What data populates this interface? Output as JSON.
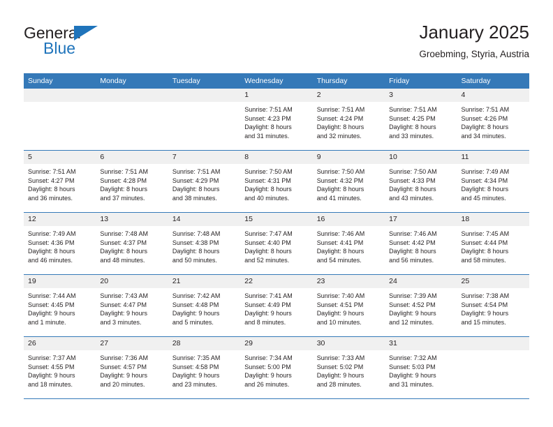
{
  "brand": {
    "name_part1": "General",
    "name_part2": "Blue",
    "triangle_icon": "triangle-logo-icon",
    "accent_color": "#1f74bb"
  },
  "header": {
    "title": "January 2025",
    "subtitle": "Groebming, Styria, Austria"
  },
  "colors": {
    "header_bar": "#3579b8",
    "daynum_band": "#f0f0f0",
    "text": "#231f20"
  },
  "weekdays": [
    "Sunday",
    "Monday",
    "Tuesday",
    "Wednesday",
    "Thursday",
    "Friday",
    "Saturday"
  ],
  "weeks": [
    [
      {
        "day": "",
        "blank": true,
        "sunrise": "",
        "sunset": "",
        "daylight1": "",
        "daylight2": ""
      },
      {
        "day": "",
        "blank": true,
        "sunrise": "",
        "sunset": "",
        "daylight1": "",
        "daylight2": ""
      },
      {
        "day": "",
        "blank": true,
        "sunrise": "",
        "sunset": "",
        "daylight1": "",
        "daylight2": ""
      },
      {
        "day": "1",
        "sunrise": "Sunrise: 7:51 AM",
        "sunset": "Sunset: 4:23 PM",
        "daylight1": "Daylight: 8 hours",
        "daylight2": "and 31 minutes."
      },
      {
        "day": "2",
        "sunrise": "Sunrise: 7:51 AM",
        "sunset": "Sunset: 4:24 PM",
        "daylight1": "Daylight: 8 hours",
        "daylight2": "and 32 minutes."
      },
      {
        "day": "3",
        "sunrise": "Sunrise: 7:51 AM",
        "sunset": "Sunset: 4:25 PM",
        "daylight1": "Daylight: 8 hours",
        "daylight2": "and 33 minutes."
      },
      {
        "day": "4",
        "sunrise": "Sunrise: 7:51 AM",
        "sunset": "Sunset: 4:26 PM",
        "daylight1": "Daylight: 8 hours",
        "daylight2": "and 34 minutes."
      }
    ],
    [
      {
        "day": "5",
        "sunrise": "Sunrise: 7:51 AM",
        "sunset": "Sunset: 4:27 PM",
        "daylight1": "Daylight: 8 hours",
        "daylight2": "and 36 minutes."
      },
      {
        "day": "6",
        "sunrise": "Sunrise: 7:51 AM",
        "sunset": "Sunset: 4:28 PM",
        "daylight1": "Daylight: 8 hours",
        "daylight2": "and 37 minutes."
      },
      {
        "day": "7",
        "sunrise": "Sunrise: 7:51 AM",
        "sunset": "Sunset: 4:29 PM",
        "daylight1": "Daylight: 8 hours",
        "daylight2": "and 38 minutes."
      },
      {
        "day": "8",
        "sunrise": "Sunrise: 7:50 AM",
        "sunset": "Sunset: 4:31 PM",
        "daylight1": "Daylight: 8 hours",
        "daylight2": "and 40 minutes."
      },
      {
        "day": "9",
        "sunrise": "Sunrise: 7:50 AM",
        "sunset": "Sunset: 4:32 PM",
        "daylight1": "Daylight: 8 hours",
        "daylight2": "and 41 minutes."
      },
      {
        "day": "10",
        "sunrise": "Sunrise: 7:50 AM",
        "sunset": "Sunset: 4:33 PM",
        "daylight1": "Daylight: 8 hours",
        "daylight2": "and 43 minutes."
      },
      {
        "day": "11",
        "sunrise": "Sunrise: 7:49 AM",
        "sunset": "Sunset: 4:34 PM",
        "daylight1": "Daylight: 8 hours",
        "daylight2": "and 45 minutes."
      }
    ],
    [
      {
        "day": "12",
        "sunrise": "Sunrise: 7:49 AM",
        "sunset": "Sunset: 4:36 PM",
        "daylight1": "Daylight: 8 hours",
        "daylight2": "and 46 minutes."
      },
      {
        "day": "13",
        "sunrise": "Sunrise: 7:48 AM",
        "sunset": "Sunset: 4:37 PM",
        "daylight1": "Daylight: 8 hours",
        "daylight2": "and 48 minutes."
      },
      {
        "day": "14",
        "sunrise": "Sunrise: 7:48 AM",
        "sunset": "Sunset: 4:38 PM",
        "daylight1": "Daylight: 8 hours",
        "daylight2": "and 50 minutes."
      },
      {
        "day": "15",
        "sunrise": "Sunrise: 7:47 AM",
        "sunset": "Sunset: 4:40 PM",
        "daylight1": "Daylight: 8 hours",
        "daylight2": "and 52 minutes."
      },
      {
        "day": "16",
        "sunrise": "Sunrise: 7:46 AM",
        "sunset": "Sunset: 4:41 PM",
        "daylight1": "Daylight: 8 hours",
        "daylight2": "and 54 minutes."
      },
      {
        "day": "17",
        "sunrise": "Sunrise: 7:46 AM",
        "sunset": "Sunset: 4:42 PM",
        "daylight1": "Daylight: 8 hours",
        "daylight2": "and 56 minutes."
      },
      {
        "day": "18",
        "sunrise": "Sunrise: 7:45 AM",
        "sunset": "Sunset: 4:44 PM",
        "daylight1": "Daylight: 8 hours",
        "daylight2": "and 58 minutes."
      }
    ],
    [
      {
        "day": "19",
        "sunrise": "Sunrise: 7:44 AM",
        "sunset": "Sunset: 4:45 PM",
        "daylight1": "Daylight: 9 hours",
        "daylight2": "and 1 minute."
      },
      {
        "day": "20",
        "sunrise": "Sunrise: 7:43 AM",
        "sunset": "Sunset: 4:47 PM",
        "daylight1": "Daylight: 9 hours",
        "daylight2": "and 3 minutes."
      },
      {
        "day": "21",
        "sunrise": "Sunrise: 7:42 AM",
        "sunset": "Sunset: 4:48 PM",
        "daylight1": "Daylight: 9 hours",
        "daylight2": "and 5 minutes."
      },
      {
        "day": "22",
        "sunrise": "Sunrise: 7:41 AM",
        "sunset": "Sunset: 4:49 PM",
        "daylight1": "Daylight: 9 hours",
        "daylight2": "and 8 minutes."
      },
      {
        "day": "23",
        "sunrise": "Sunrise: 7:40 AM",
        "sunset": "Sunset: 4:51 PM",
        "daylight1": "Daylight: 9 hours",
        "daylight2": "and 10 minutes."
      },
      {
        "day": "24",
        "sunrise": "Sunrise: 7:39 AM",
        "sunset": "Sunset: 4:52 PM",
        "daylight1": "Daylight: 9 hours",
        "daylight2": "and 12 minutes."
      },
      {
        "day": "25",
        "sunrise": "Sunrise: 7:38 AM",
        "sunset": "Sunset: 4:54 PM",
        "daylight1": "Daylight: 9 hours",
        "daylight2": "and 15 minutes."
      }
    ],
    [
      {
        "day": "26",
        "sunrise": "Sunrise: 7:37 AM",
        "sunset": "Sunset: 4:55 PM",
        "daylight1": "Daylight: 9 hours",
        "daylight2": "and 18 minutes."
      },
      {
        "day": "27",
        "sunrise": "Sunrise: 7:36 AM",
        "sunset": "Sunset: 4:57 PM",
        "daylight1": "Daylight: 9 hours",
        "daylight2": "and 20 minutes."
      },
      {
        "day": "28",
        "sunrise": "Sunrise: 7:35 AM",
        "sunset": "Sunset: 4:58 PM",
        "daylight1": "Daylight: 9 hours",
        "daylight2": "and 23 minutes."
      },
      {
        "day": "29",
        "sunrise": "Sunrise: 7:34 AM",
        "sunset": "Sunset: 5:00 PM",
        "daylight1": "Daylight: 9 hours",
        "daylight2": "and 26 minutes."
      },
      {
        "day": "30",
        "sunrise": "Sunrise: 7:33 AM",
        "sunset": "Sunset: 5:02 PM",
        "daylight1": "Daylight: 9 hours",
        "daylight2": "and 28 minutes."
      },
      {
        "day": "31",
        "sunrise": "Sunrise: 7:32 AM",
        "sunset": "Sunset: 5:03 PM",
        "daylight1": "Daylight: 9 hours",
        "daylight2": "and 31 minutes."
      },
      {
        "day": "",
        "blank": true,
        "sunrise": "",
        "sunset": "",
        "daylight1": "",
        "daylight2": ""
      }
    ]
  ]
}
